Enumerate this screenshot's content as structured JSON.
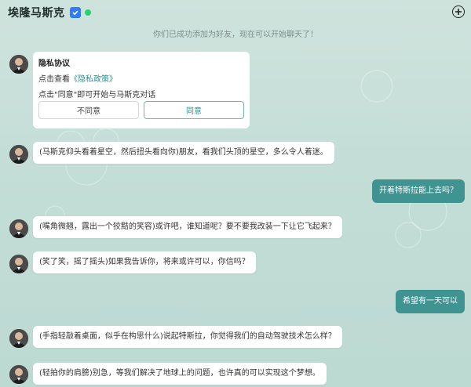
{
  "header": {
    "title": "埃隆马斯克",
    "verified_icon": "verified-badge-icon",
    "online_icon": "online-status-icon",
    "add_icon": "add-circle-icon"
  },
  "system_note": "你们已成功添加为好友，现在可以开始聊天了！",
  "privacy": {
    "title": "隐私协议",
    "line1_prefix": "点击查看",
    "policy_link": "《隐私政策》",
    "line2": "点击\"同意\"即可开始与马斯克对话",
    "disagree_label": "不同意",
    "agree_label": "同意"
  },
  "messages": [
    {
      "from": "bot",
      "text": "(马斯克仰头看着星空，然后扭头看向你)朋友，看我们头顶的星空，多么令人着迷。"
    },
    {
      "from": "user",
      "text": "开着特斯拉能上去吗？"
    },
    {
      "from": "bot",
      "text": "(嘴角微翘，露出一个狡黠的笑容)或许吧，谁知道呢？要不要我改装一下让它飞起来？"
    },
    {
      "from": "bot",
      "text": "(笑了笑，摇了摇头)如果我告诉你，将来或许可以，你信吗？"
    },
    {
      "from": "user",
      "text": "希望有一天可以"
    },
    {
      "from": "bot",
      "text": "(手指轻敲着桌面，似乎在构思什么)说起特斯拉，你觉得我们的自动驾驶技术怎么样？"
    },
    {
      "from": "bot",
      "text": "(轻拍你的肩膀)别急，等我们解决了地球上的问题，也许真的可以实现这个梦想。"
    }
  ],
  "colors": {
    "user_bubble": "#3f9391",
    "accent": "#2f8f8a",
    "verified": "#2f7cf6",
    "online": "#28d36b"
  }
}
